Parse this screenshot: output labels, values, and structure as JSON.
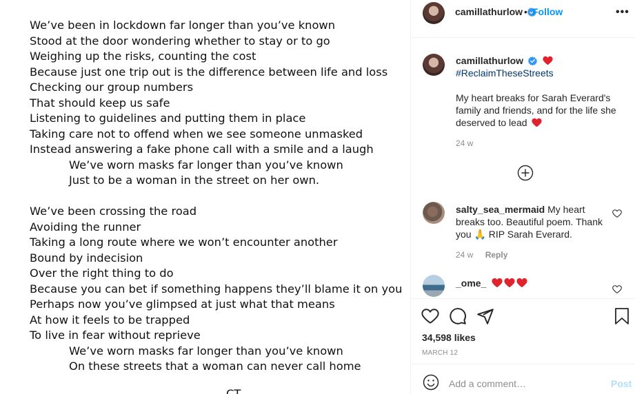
{
  "poem": {
    "stanza1": [
      "We’ve been in lockdown far longer than you’ve known",
      "Stood at the door wondering whether to stay or to go",
      "Weighing up the risks, counting the cost",
      "Because just one trip out is the difference between life and loss",
      "Checking our group numbers",
      "That should keep us safe",
      "Listening to guidelines and putting them in place",
      "Taking care not to offend when we see someone unmasked",
      "Instead answering a fake phone call with a smile and a laugh"
    ],
    "refrain1": [
      "We’ve worn masks far longer than you’ve known",
      "Just to be a woman in the street on her own."
    ],
    "stanza2": [
      "We’ve been crossing the road",
      "Avoiding the runner",
      "Taking a long route where we won’t encounter another",
      "Bound by indecision",
      "Over the right thing to do",
      "Because you can bet if something happens they’ll blame it on you",
      "Perhaps now you’ve glimpsed at just what that means",
      "At how it feels to be trapped",
      "To live in fear without reprieve"
    ],
    "refrain2": [
      "We’ve worn masks far longer than you’ve known",
      "On these streets that a woman can never call home"
    ],
    "signature": "CT"
  },
  "header": {
    "username": "camillathurlow",
    "separator": "•",
    "follow_label": "Follow",
    "more_label": "•••"
  },
  "caption": {
    "username": "camillathurlow",
    "hashtag": "#ReclaimTheseStreets",
    "text": "My heart breaks for Sarah Everard's family and friends, and for the life she deserved to lead",
    "time": "24 w"
  },
  "comments": [
    {
      "username": "salty_sea_mermaid",
      "text": "My heart breaks too. Beautiful poem. Thank you 🙏 RIP Sarah Everard.",
      "time": "24 w",
      "reply_label": "Reply"
    },
    {
      "username": "_ome_",
      "text": ""
    }
  ],
  "post": {
    "likes": "34,598 likes",
    "date": "MARCH 12"
  },
  "add_comment": {
    "placeholder": "Add a comment…",
    "post_label": "Post"
  },
  "colors": {
    "link_blue": "#0095f6",
    "hashtag_blue": "#00376b",
    "heart_red": "#ed4956",
    "muted": "#8e8e8e",
    "post_disabled": "#b2dffc"
  },
  "icons": {
    "verified": "verified-badge-icon",
    "heart": "heart-icon",
    "comment": "comment-icon",
    "share": "paper-plane-icon",
    "save": "bookmark-icon",
    "load_more": "plus-circle-icon",
    "emoji": "smiley-icon"
  }
}
